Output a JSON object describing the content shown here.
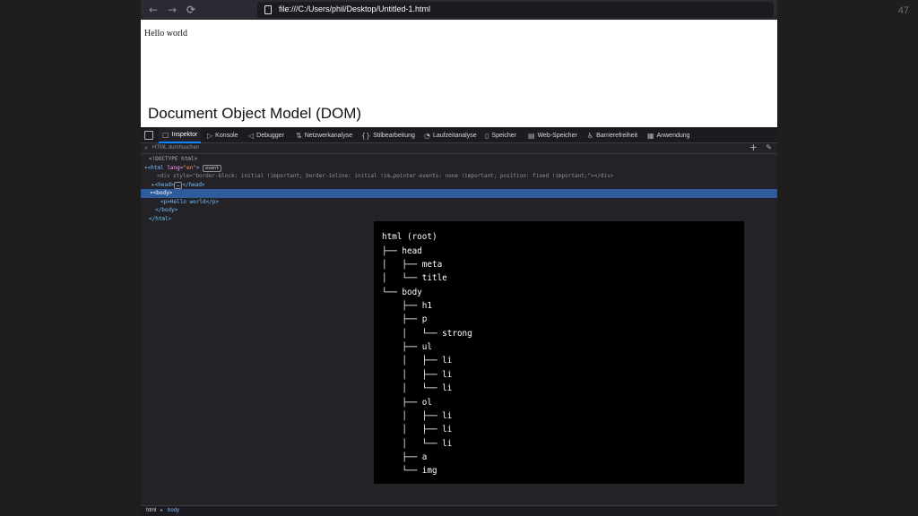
{
  "slide_number": "47",
  "browser": {
    "nav": {
      "back": "←",
      "forward": "→",
      "reload": "C"
    },
    "url": "file:///C:/Users/phil/Desktop/Untitled-1.html"
  },
  "viewport": {
    "hello_text": "Hello world",
    "caption": "Document Object Model (DOM)"
  },
  "devtools": {
    "tabs": [
      {
        "icon": "▢",
        "label": "Inspektor"
      },
      {
        "icon": "▷",
        "label": "Konsole"
      },
      {
        "icon": "◁",
        "label": "Debugger"
      },
      {
        "icon": "⇅",
        "label": "Netzwerkanalyse"
      },
      {
        "icon": "{}",
        "label": "Stilbearbeitung"
      },
      {
        "icon": "◔",
        "label": "Laufzeitanalyse"
      },
      {
        "icon": "▯",
        "label": "Speicher"
      },
      {
        "icon": "▤",
        "label": "Web-Speicher"
      },
      {
        "icon": "♿",
        "label": "Barrierefreiheit"
      },
      {
        "icon": "▦",
        "label": "Anwendung"
      }
    ],
    "search_placeholder": "HTML durchsuchen",
    "markup": {
      "doctype": "<!DOCTYPE html>",
      "html_open_tag": "<html",
      "html_attr": "lang=",
      "html_attr_val": "\"en\"",
      "html_close_bracket": ">",
      "event_badge": "event",
      "div_line": "<div style=\"border-block: initial !important; border-inline: initial !im…pointer-events: none !important; position: fixed !important;\"></div>",
      "head_open": "<head>",
      "head_badge": "…",
      "head_close": "</head>",
      "body_open": "<body>",
      "p_line": "<p>Hello world</p>",
      "body_close": "</body>",
      "html_close": "</html>"
    },
    "breadcrumb": [
      "html",
      "body"
    ]
  },
  "dom_tree": [
    "html (root)",
    "├── head",
    "│   ├── meta",
    "│   └── title",
    "└── body",
    "    ├── h1",
    "    ├── p",
    "    │   └── strong",
    "    ├── ul",
    "    │   ├── li",
    "    │   ├── li",
    "    │   └── li",
    "    ├── ol",
    "    │   ├── li",
    "    │   ├── li",
    "    │   └── li",
    "    ├── a",
    "    └── img"
  ]
}
